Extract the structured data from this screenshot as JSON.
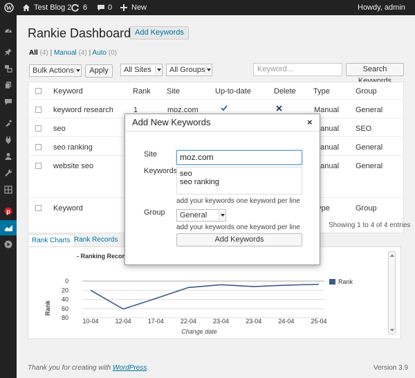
{
  "adminbar": {
    "site_name": "Test Blog 2",
    "updates_count": "6",
    "comments_count": "0",
    "new_label": "New",
    "howdy": "Howdy, admin"
  },
  "page": {
    "title": "Rankie Dashboard",
    "add_keywords_button": "Add Keywords"
  },
  "filters": {
    "all": {
      "label": "All",
      "count": "(4)"
    },
    "manual": {
      "label": "Manual",
      "count": "(4)"
    },
    "auto": {
      "label": "Auto",
      "count": "(0)"
    },
    "sep": "|"
  },
  "toolbar": {
    "bulk_actions": "Bulk Actions",
    "apply": "Apply",
    "all_sites": "All Sites",
    "all_groups": "All Groups",
    "search_placeholder": "Keyword...",
    "search_button": "Search Keywords"
  },
  "table": {
    "headers": [
      "Keyword",
      "Rank",
      "Site",
      "Up-to-date",
      "Delete",
      "Type",
      "Group"
    ],
    "rows": [
      {
        "keyword": "keyword research",
        "rank": "1",
        "site": "moz.com",
        "type": "Manual",
        "group": "General"
      },
      {
        "keyword": "seo",
        "type": "Manual",
        "group": "SEO"
      },
      {
        "keyword": "seo ranking",
        "type": "Manual",
        "group": "General"
      },
      {
        "keyword": "website seo",
        "type": "Manual",
        "group": "General"
      }
    ],
    "footer_keyword": "Keyword",
    "footer_type": "Type",
    "footer_group": "Group",
    "showing": "Showing 1 to 4 of 4 entries"
  },
  "tabs": {
    "rank_charts": "Rank Charts",
    "rank_records": "Rank Records"
  },
  "chart_data": {
    "type": "line",
    "title": "- Ranking Records",
    "xlabel": "Change date",
    "ylabel": "Rank",
    "categories": [
      "10-04",
      "12-04",
      "17-04",
      "22-04",
      "23-04",
      "23-04",
      "24-04",
      "25-04"
    ],
    "y_ticks": [
      "0",
      "20",
      "40",
      "60",
      "80"
    ],
    "ylim": [
      0,
      80
    ],
    "y_inverted": true,
    "series": [
      {
        "name": "Rank",
        "values": [
          20,
          61,
          38,
          14,
          8,
          12,
          9,
          7
        ],
        "color": "#3c5a8c"
      }
    ],
    "legend": "right"
  },
  "modal": {
    "title": "Add New Keywords",
    "close": "×",
    "site_label": "Site",
    "site_value": "moz.com",
    "keywords_label": "Keywords",
    "keywords_value": "seo\nseo ranking",
    "hint1": "add your keywords one keyword per line",
    "group_label": "Group",
    "group_value": "General",
    "hint2": "add your keywords one keyword per line",
    "submit": "Add Keywords"
  },
  "footer": {
    "thanks_prefix": "Thank you for creating with ",
    "thanks_link": "WordPress",
    "thanks_suffix": ".",
    "version": "Version 3.9"
  },
  "colors": {
    "adminbar_bg": "#222222",
    "accent": "#0074a2",
    "check_green": "#2a6496",
    "delete_x": "#1e3a5f"
  }
}
